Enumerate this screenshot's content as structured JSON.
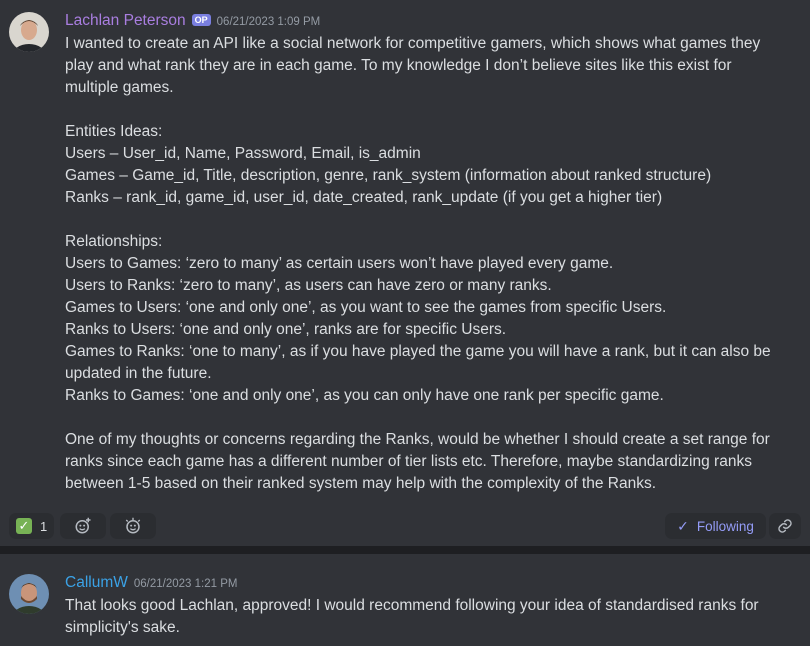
{
  "messages": [
    {
      "author": "Lachlan Peterson",
      "author_color": "#a97ee0",
      "badge": "OP",
      "timestamp": "06/21/2023 1:09 PM",
      "lines": [
        "I wanted to create an API like a social network for competitive gamers, which shows what games they",
        "play and what rank they are in each game. To my knowledge I don’t believe sites like this exist for",
        "multiple games.",
        "",
        "Entities Ideas:",
        "Users – User_id, Name, Password, Email, is_admin",
        "Games – Game_id, Title, description, genre,  rank_system (information about ranked structure)",
        "Ranks – rank_id, game_id, user_id, date_created, rank_update (if you get a higher tier)",
        "",
        "Relationships:",
        "Users to Games: ‘zero to many’ as certain users won’t have played every game.",
        "Users to Ranks: ‘zero to many’, as users can have zero or many ranks.",
        "Games to Users: ‘one and only one’, as you want to see the games from  specific Users.",
        "Ranks to Users: ‘one and only one’, ranks are for specific Users.",
        "Games to Ranks: ‘one to many’, as if you have played the game you will have a rank, but it can also be",
        "updated in the future.",
        "Ranks to Games: ‘one and only one’, as you can only have one rank per specific game.",
        "",
        "One of my thoughts or concerns regarding the Ranks, would be whether I should create a set range for",
        "ranks since each game has a different number of tier lists etc. Therefore, maybe standardizing ranks",
        "between 1-5 based on their ranked system may help with the complexity of the Ranks."
      ]
    },
    {
      "author": "CallumW",
      "author_color": "#3ba2e6",
      "timestamp": "06/21/2023 1:21 PM",
      "lines": [
        "That looks good Lachlan, approved! I would recommend following your idea of standardised ranks for",
        "simplicity's sake."
      ]
    }
  ],
  "reactions": {
    "check_count": "1",
    "check_icon": "check-mark-emoji",
    "add_reaction_icon": "smile-plus-icon",
    "add_super_reaction_icon": "super-reaction-icon"
  },
  "thread": {
    "following_label": "Following",
    "link_icon": "link-icon"
  }
}
